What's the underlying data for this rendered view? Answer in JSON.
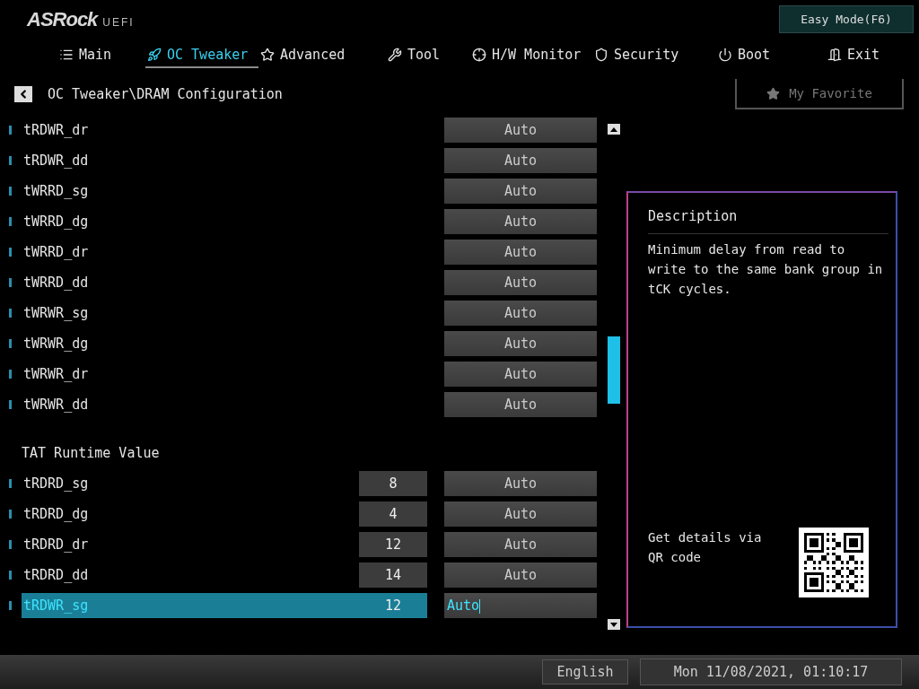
{
  "header": {
    "logo": "ASRock",
    "logo_suffix": "UEFI",
    "mode_button": "Easy Mode(F6)"
  },
  "tabs": [
    {
      "label": "Main",
      "selected": false
    },
    {
      "label": "OC Tweaker",
      "selected": true
    },
    {
      "label": "Advanced",
      "selected": false
    },
    {
      "label": "Tool",
      "selected": false
    },
    {
      "label": "H/W Monitor",
      "selected": false
    },
    {
      "label": "Security",
      "selected": false
    },
    {
      "label": "Boot",
      "selected": false
    },
    {
      "label": "Exit",
      "selected": false
    }
  ],
  "breadcrumb": {
    "path": "OC Tweaker\\DRAM Configuration",
    "favorite": "My Favorite"
  },
  "items": [
    {
      "kind": "setting",
      "name": "tRDWR_dr",
      "option": "Auto",
      "selected": false
    },
    {
      "kind": "setting",
      "name": "tRDWR_dd",
      "option": "Auto",
      "selected": false
    },
    {
      "kind": "setting",
      "name": "tWRRD_sg",
      "option": "Auto",
      "selected": false
    },
    {
      "kind": "setting",
      "name": "tWRRD_dg",
      "option": "Auto",
      "selected": false
    },
    {
      "kind": "setting",
      "name": "tWRRD_dr",
      "option": "Auto",
      "selected": false
    },
    {
      "kind": "setting",
      "name": "tWRRD_dd",
      "option": "Auto",
      "selected": false
    },
    {
      "kind": "setting",
      "name": "tWRWR_sg",
      "option": "Auto",
      "selected": false
    },
    {
      "kind": "setting",
      "name": "tWRWR_dg",
      "option": "Auto",
      "selected": false
    },
    {
      "kind": "setting",
      "name": "tWRWR_dr",
      "option": "Auto",
      "selected": false
    },
    {
      "kind": "setting",
      "name": "tWRWR_dd",
      "option": "Auto",
      "selected": false
    },
    {
      "kind": "section",
      "name": "TAT Runtime Value"
    },
    {
      "kind": "setting",
      "name": "tRDRD_sg",
      "current": "8",
      "option": "Auto",
      "selected": false
    },
    {
      "kind": "setting",
      "name": "tRDRD_dg",
      "current": "4",
      "option": "Auto",
      "selected": false
    },
    {
      "kind": "setting",
      "name": "tRDRD_dr",
      "current": "12",
      "option": "Auto",
      "selected": false
    },
    {
      "kind": "setting",
      "name": "tRDRD_dd",
      "current": "14",
      "option": "Auto",
      "selected": false
    },
    {
      "kind": "setting",
      "name": "tRDWR_sg",
      "current": "12",
      "option": "Auto",
      "selected": true
    }
  ],
  "description": {
    "title": "Description",
    "text": "Minimum delay from read to write to the same bank group in tCK cycles.",
    "qr_caption": "Get details via QR code"
  },
  "status_bar": {
    "language": "English",
    "datetime": "Mon 11/08/2021, 01:10:17"
  }
}
